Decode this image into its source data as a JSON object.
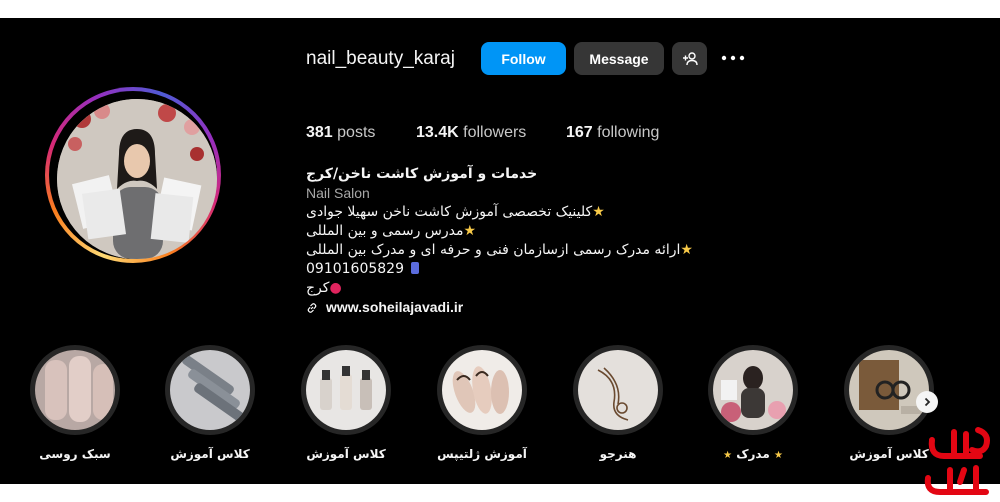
{
  "profile": {
    "username": "nail_beauty_karaj",
    "follow_label": "Follow",
    "message_label": "Message",
    "add_user_icon": "add-user-icon",
    "more_icon": "more-options-icon"
  },
  "stats": {
    "posts_count": "381",
    "posts_label": "posts",
    "followers_count": "13.4K",
    "followers_label": "followers",
    "following_count": "167",
    "following_label": "following"
  },
  "bio": {
    "title": "خدمات و آموزش کاشت ناخن/کرج",
    "category": "Nail Salon",
    "line1": "کلینیک تخصصی آموزش کاشت ناخن سهیلا جوادی",
    "line2": "مدرس رسمی و بین المللی",
    "line3": "ارائه مدرک رسمی ازسازمان فنی و حرفه ای و مدرک بین المللی",
    "phone": "09101605829",
    "location": "کرج",
    "link": "www.soheilajavadi.ir"
  },
  "highlights": [
    {
      "label": "سبک روسی"
    },
    {
      "label": "کلاس آموزش"
    },
    {
      "label": "کلاس آموزش"
    },
    {
      "label": "آموزش ژلتیپس"
    },
    {
      "label": "هنرجو"
    },
    {
      "label": "مدرک"
    },
    {
      "label": "کلاس آموزش"
    }
  ],
  "watermark": "کافه کارا",
  "colors": {
    "background": "#000000",
    "follow_button": "#0095f6",
    "secondary_button": "#363636",
    "text": "#f5f5f5",
    "muted": "#a8a8a8",
    "watermark": "#e30613"
  }
}
